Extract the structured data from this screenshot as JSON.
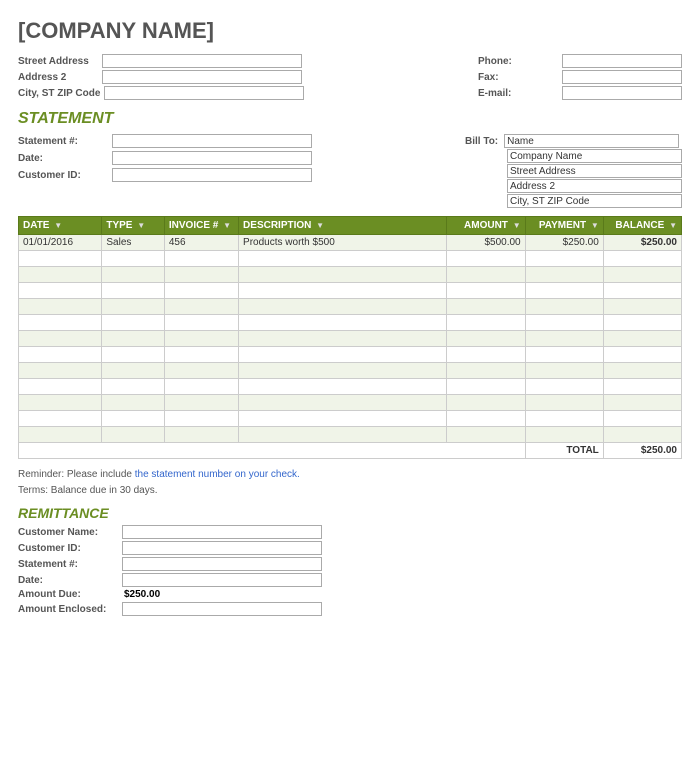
{
  "company": {
    "name": "[COMPANY NAME]"
  },
  "header": {
    "left": {
      "street_address_label": "Street Address",
      "address2_label": "Address 2",
      "city_label": "City, ST  ZIP Code"
    },
    "right": {
      "phone_label": "Phone:",
      "fax_label": "Fax:",
      "email_label": "E-mail:"
    }
  },
  "statement_title": "STATEMENT",
  "statement": {
    "number_label": "Statement #:",
    "date_label": "Date:",
    "customer_id_label": "Customer ID:",
    "bill_to_label": "Bill To:",
    "bill_to_name": "Name",
    "bill_to_company": "Company Name",
    "bill_to_street": "Street Address",
    "bill_to_address2": "Address 2",
    "bill_to_city": "City, ST  ZIP Code"
  },
  "table": {
    "columns": [
      {
        "id": "date",
        "label": "DATE"
      },
      {
        "id": "type",
        "label": "TYPE"
      },
      {
        "id": "invoice",
        "label": "INVOICE #"
      },
      {
        "id": "description",
        "label": "DESCRIPTION"
      },
      {
        "id": "amount",
        "label": "AMOUNT"
      },
      {
        "id": "payment",
        "label": "PAYMENT"
      },
      {
        "id": "balance",
        "label": "BALANCE"
      }
    ],
    "rows": [
      {
        "date": "01/01/2016",
        "type": "Sales",
        "invoice": "456",
        "description": "Products worth $500",
        "amount": "$500.00",
        "payment": "$250.00",
        "balance": "$250.00"
      },
      {
        "date": "",
        "type": "",
        "invoice": "",
        "description": "",
        "amount": "",
        "payment": "",
        "balance": ""
      },
      {
        "date": "",
        "type": "",
        "invoice": "",
        "description": "",
        "amount": "",
        "payment": "",
        "balance": ""
      },
      {
        "date": "",
        "type": "",
        "invoice": "",
        "description": "",
        "amount": "",
        "payment": "",
        "balance": ""
      },
      {
        "date": "",
        "type": "",
        "invoice": "",
        "description": "",
        "amount": "",
        "payment": "",
        "balance": ""
      },
      {
        "date": "",
        "type": "",
        "invoice": "",
        "description": "",
        "amount": "",
        "payment": "",
        "balance": ""
      },
      {
        "date": "",
        "type": "",
        "invoice": "",
        "description": "",
        "amount": "",
        "payment": "",
        "balance": ""
      },
      {
        "date": "",
        "type": "",
        "invoice": "",
        "description": "",
        "amount": "",
        "payment": "",
        "balance": ""
      },
      {
        "date": "",
        "type": "",
        "invoice": "",
        "description": "",
        "amount": "",
        "payment": "",
        "balance": ""
      },
      {
        "date": "",
        "type": "",
        "invoice": "",
        "description": "",
        "amount": "",
        "payment": "",
        "balance": ""
      },
      {
        "date": "",
        "type": "",
        "invoice": "",
        "description": "",
        "amount": "",
        "payment": "",
        "balance": ""
      },
      {
        "date": "",
        "type": "",
        "invoice": "",
        "description": "",
        "amount": "",
        "payment": "",
        "balance": ""
      },
      {
        "date": "",
        "type": "",
        "invoice": "",
        "description": "",
        "amount": "",
        "payment": "",
        "balance": ""
      }
    ],
    "total_label": "TOTAL",
    "total_value": "$250.00"
  },
  "reminder": {
    "line1_prefix": "Reminder: Please include ",
    "line1_link": "the statement number on your check.",
    "line2": "Terms: Balance due in 30 days."
  },
  "remittance": {
    "title": "REMITTANCE",
    "customer_name_label": "Customer Name:",
    "customer_id_label": "Customer ID:",
    "statement_label": "Statement #:",
    "date_label": "Date:",
    "amount_due_label": "Amount Due:",
    "amount_due_value": "$250.00",
    "amount_enclosed_label": "Amount Enclosed:"
  }
}
